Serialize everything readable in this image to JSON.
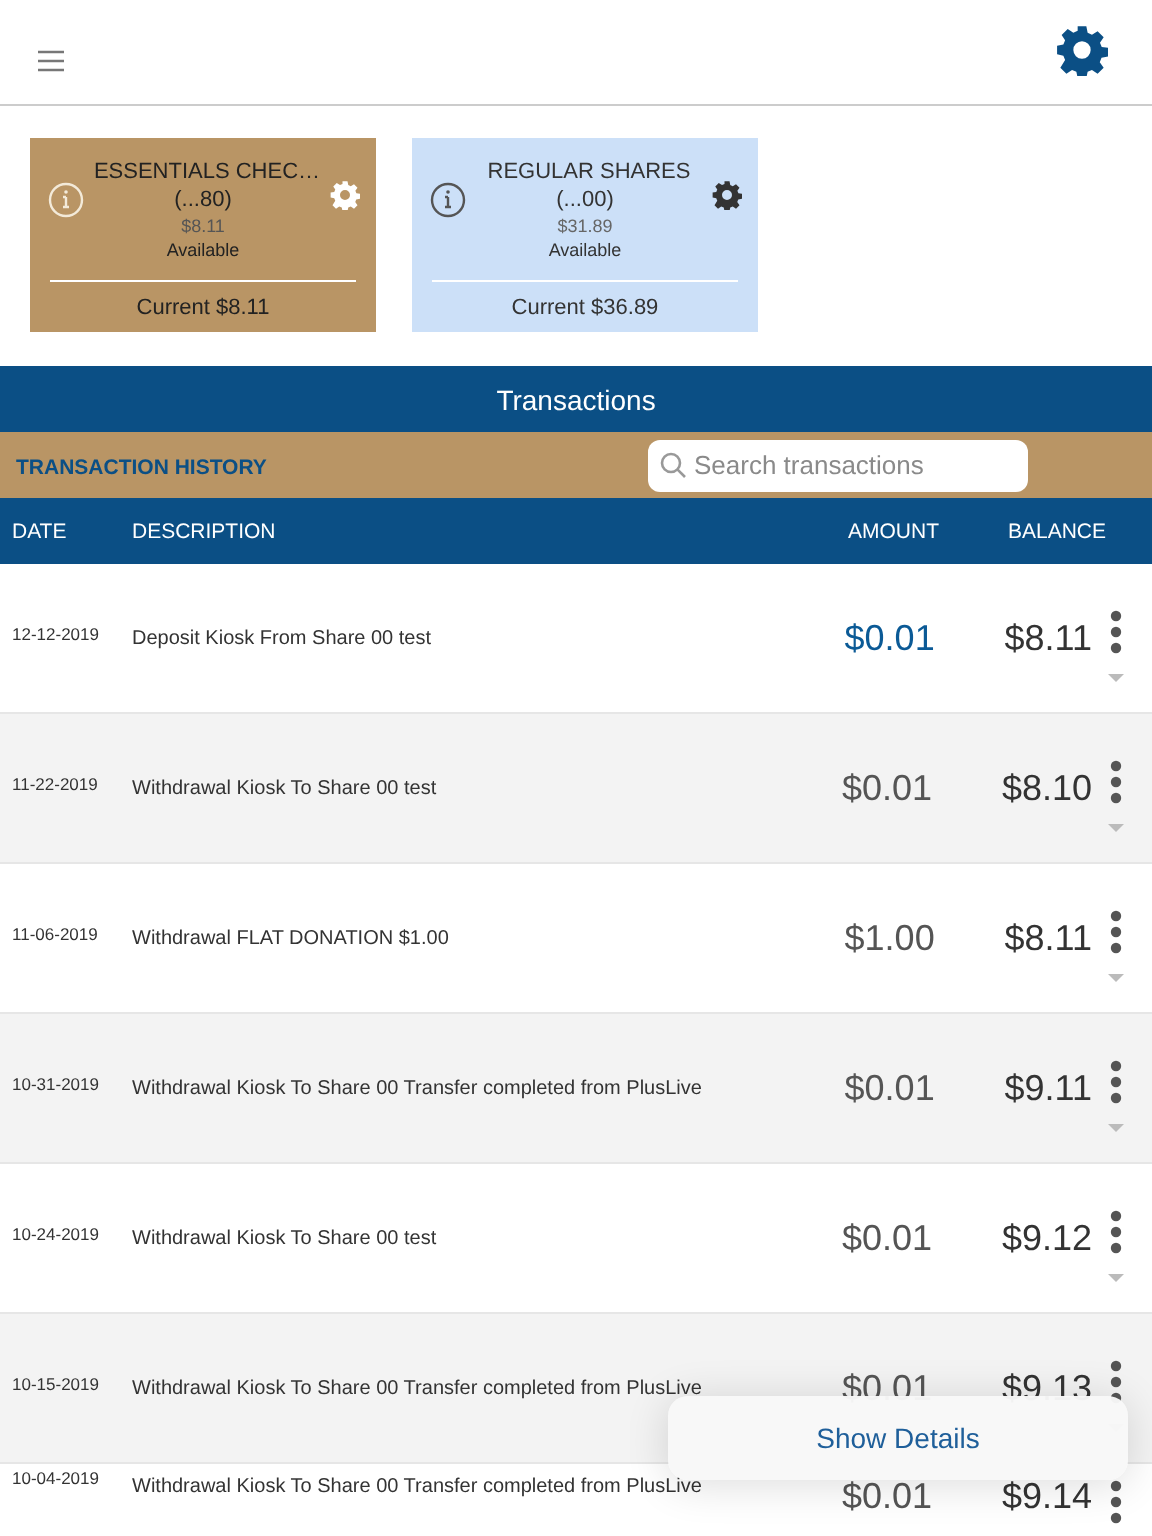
{
  "accounts": [
    {
      "name": "ESSENTIALS CHEC…",
      "number": "(...80)",
      "available_amount": "$8.11",
      "available_label": "Available",
      "current": "Current $8.11",
      "selected": true
    },
    {
      "name": "REGULAR SHARES",
      "number": "(...00)",
      "available_amount": "$31.89",
      "available_label": "Available",
      "current": "Current $36.89",
      "selected": false
    }
  ],
  "section_title": "Transactions",
  "history_label": "TRANSACTION HISTORY",
  "search": {
    "placeholder": "Search transactions"
  },
  "columns": [
    "DATE",
    "DESCRIPTION",
    "AMOUNT",
    "BALANCE"
  ],
  "rows": [
    {
      "date": "12-12-2019",
      "description": "Deposit Kiosk From Share 00 test",
      "amount": "$0.01",
      "balance": "$8.11",
      "kind": "credit"
    },
    {
      "date": "11-22-2019",
      "description": "Withdrawal Kiosk To Share 00 test",
      "amount": "$0.01",
      "balance": "$8.10",
      "kind": "debit"
    },
    {
      "date": "11-06-2019",
      "description": "Withdrawal FLAT DONATION $1.00",
      "amount": "$1.00",
      "balance": "$8.11",
      "kind": "debit"
    },
    {
      "date": "10-31-2019",
      "description": "Withdrawal Kiosk To Share 00 Transfer completed from PlusLive",
      "amount": "$0.01",
      "balance": "$9.11",
      "kind": "debit"
    },
    {
      "date": "10-24-2019",
      "description": "Withdrawal Kiosk To Share 00 test",
      "amount": "$0.01",
      "balance": "$9.12",
      "kind": "debit"
    },
    {
      "date": "10-15-2019",
      "description": "Withdrawal Kiosk To Share 00 Transfer completed from PlusLive",
      "amount": "$0.01",
      "balance": "$9.13",
      "kind": "debit"
    },
    {
      "date": "10-04-2019",
      "description": "Withdrawal Kiosk To Share 00 Transfer completed from PlusLive",
      "amount": "$0.01",
      "balance": "$9.14",
      "kind": "debit"
    }
  ],
  "popover": {
    "label": "Show Details"
  }
}
